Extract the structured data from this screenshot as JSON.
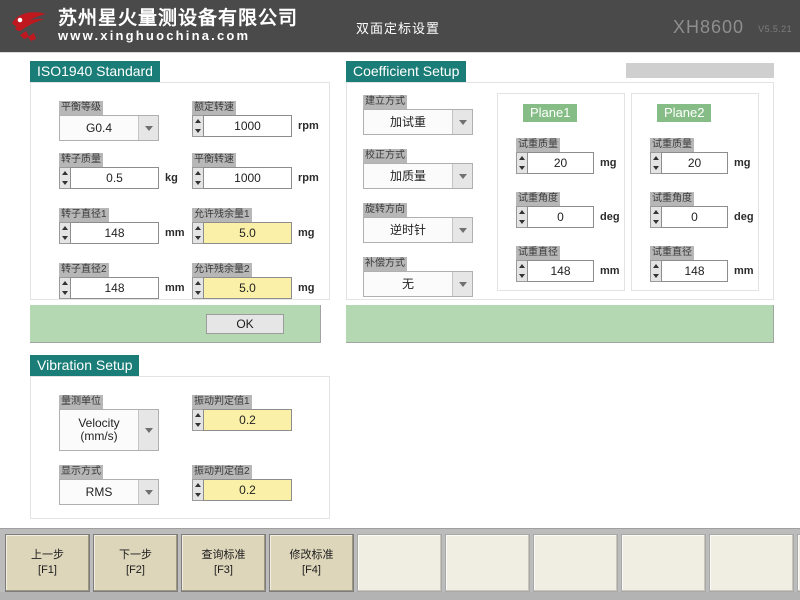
{
  "header": {
    "company_cn": "苏州星火量测设备有限公司",
    "company_url": "www.xinghuochina.com",
    "title": "双面定标设置",
    "model": "XH8600",
    "version": "V5.5.21"
  },
  "iso_panel": {
    "title": "ISO1940 Standard",
    "fields": [
      {
        "label": "平衡等级",
        "value": "G0.4",
        "unit": "",
        "type": "combo"
      },
      {
        "label": "额定转速",
        "value": "1000",
        "unit": "rpm",
        "type": "spin"
      },
      {
        "label": "转子质量",
        "value": "0.5",
        "unit": "kg",
        "type": "spin"
      },
      {
        "label": "平衡转速",
        "value": "1000",
        "unit": "rpm",
        "type": "spin"
      },
      {
        "label": "转子直径1",
        "value": "148",
        "unit": "mm",
        "type": "spin"
      },
      {
        "label": "允许残余量1",
        "value": "5.0",
        "unit": "mg",
        "type": "spin-yellow"
      },
      {
        "label": "转子直径2",
        "value": "148",
        "unit": "mm",
        "type": "spin"
      },
      {
        "label": "允许残余量2",
        "value": "5.0",
        "unit": "mg",
        "type": "spin-yellow"
      }
    ],
    "ok_label": "OK"
  },
  "coefficient_panel": {
    "title": "Coefficient Setup",
    "fields": [
      {
        "label": "建立方式",
        "value": "加试重"
      },
      {
        "label": "校正方式",
        "value": "加质量"
      },
      {
        "label": "旋转方向",
        "value": "逆时针"
      },
      {
        "label": "补偿方式",
        "value": "无"
      }
    ],
    "planes": [
      {
        "tag": "Plane1",
        "fields": [
          {
            "label": "试重质量",
            "value": "20",
            "unit": "mg"
          },
          {
            "label": "试重角度",
            "value": "0",
            "unit": "deg"
          },
          {
            "label": "试重直径",
            "value": "148",
            "unit": "mm"
          }
        ]
      },
      {
        "tag": "Plane2",
        "fields": [
          {
            "label": "试重质量",
            "value": "20",
            "unit": "mg"
          },
          {
            "label": "试重角度",
            "value": "0",
            "unit": "deg"
          },
          {
            "label": "试重直径",
            "value": "148",
            "unit": "mm"
          }
        ]
      }
    ]
  },
  "vibration_panel": {
    "title": "Vibration Setup",
    "fields": [
      {
        "label": "量测单位",
        "value_line1": "Velocity",
        "value_line2": "(mm/s)",
        "type": "combo2"
      },
      {
        "label": "振动判定值1",
        "value": "0.2",
        "unit": "",
        "type": "spin-yellow"
      },
      {
        "label": "显示方式",
        "value": "RMS",
        "type": "combo"
      },
      {
        "label": "振动判定值2",
        "value": "0.2",
        "unit": "",
        "type": "spin-yellow"
      }
    ]
  },
  "bottom_bar": {
    "keys": [
      {
        "label": "上一步",
        "key": "[F1]",
        "enabled": true
      },
      {
        "label": "下一步",
        "key": "[F2]",
        "enabled": true
      },
      {
        "label": "查询标准",
        "key": "[F3]",
        "enabled": true
      },
      {
        "label": "修改标准",
        "key": "[F4]",
        "enabled": true
      },
      {
        "label": "",
        "key": "",
        "enabled": false
      },
      {
        "label": "",
        "key": "",
        "enabled": false
      },
      {
        "label": "",
        "key": "",
        "enabled": false
      },
      {
        "label": "",
        "key": "",
        "enabled": false
      },
      {
        "label": "",
        "key": "",
        "enabled": false
      },
      {
        "label": "",
        "key": "",
        "enabled": false
      }
    ]
  },
  "colors": {
    "header_bg": "#4a4a4a",
    "panel_title_bg": "#1b7d77",
    "plane_tag_bg": "#86bd86",
    "green_bar": "#b4d8b2",
    "yellow_field": "#faf0a8",
    "fkey_bg": "#ded6bb"
  }
}
